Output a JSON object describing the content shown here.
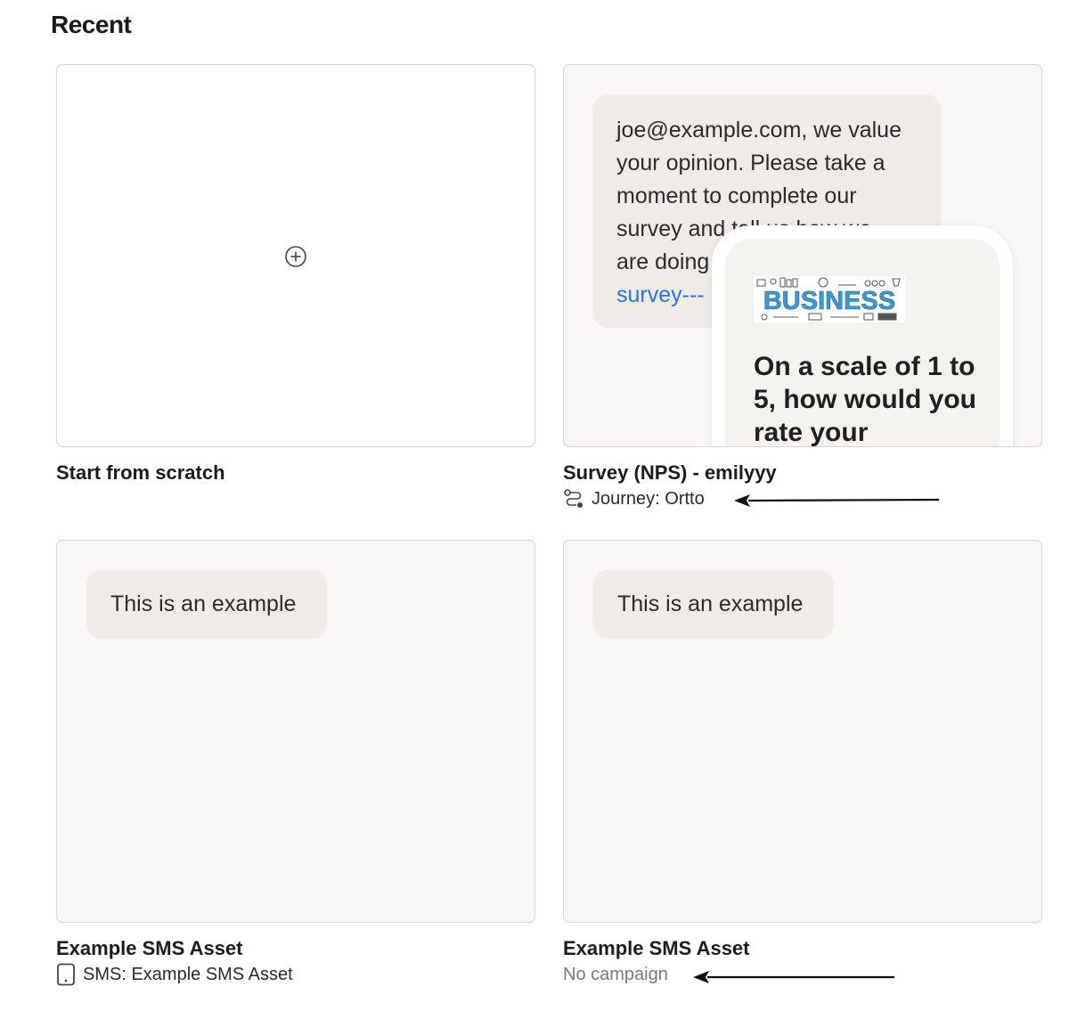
{
  "heading": "Recent",
  "cards": [
    {
      "title": "Start from scratch",
      "preview_icon": "plus-circle-icon"
    },
    {
      "title": "Survey (NPS) - emilyyy",
      "subtitle": "Journey: Ortto",
      "subtitle_icon": "journey-icon",
      "preview": {
        "message_lines": [
          "joe@example.com, we value",
          "your opinion. Please take a",
          "moment to complete our",
          "survey and tell us how we",
          "are doing"
        ],
        "message_link": "survey---",
        "image_text": "BUSINESS",
        "question": "On a scale of 1 to 5, how would you rate your"
      }
    },
    {
      "title": "Example SMS Asset",
      "subtitle": "SMS: Example SMS Asset",
      "subtitle_icon": "phone-icon",
      "preview": {
        "message": "This is an example"
      }
    },
    {
      "title": "Example SMS Asset",
      "subtitle": "No campaign",
      "preview": {
        "message": "This is an example"
      }
    }
  ],
  "colors": {
    "preview_bg": "#f7f6f4",
    "bubble_bg": "#efece8",
    "link": "#2f6fe6",
    "muted_text": "#7a7a7a",
    "business_blue": "#3a9ad9"
  }
}
